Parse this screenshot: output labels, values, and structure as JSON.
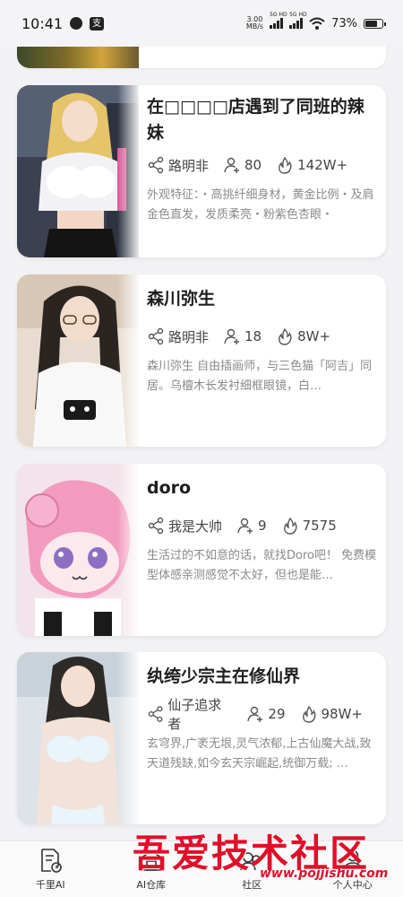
{
  "status_bar": {
    "time": "10:41",
    "notif_badge": "支",
    "net_speed_value": "3.00",
    "net_speed_unit": "MB/s",
    "sim1_tag": "5G HD",
    "sim2_tag": "5G HD",
    "battery": "73%"
  },
  "cards": [
    {
      "title": "在□□□□店遇到了同班的辣妹",
      "author": "路明非",
      "users": "80",
      "heat": "142W+",
      "description": "外观特征：・高挑纤细身材，黄金比例・及肩金色直发，发质柔亮・粉紫色杏眼・"
    },
    {
      "title": "森川弥生",
      "author": "路明非",
      "users": "18",
      "heat": "8W+",
      "description": "森川弥生 自由插画师，与三色猫「阿吉」同居。乌檀木长发衬细框眼镜，白…"
    },
    {
      "title": "doro",
      "author": "我是大帅",
      "users": "9",
      "heat": "7575",
      "description": "生活过的不如意的话，就找Doro吧！ 免费模型体感亲测感觉不太好，但也是能…"
    },
    {
      "title": "纨绔少宗主在修仙界",
      "author": "仙子追求者",
      "users": "29",
      "heat": "98W+",
      "description": "玄穹界,广袤无垠,灵气浓郁,上古仙魔大战,致天道残缺,如今玄天宗崛起,统御万载; …"
    }
  ],
  "nav": {
    "items": [
      {
        "label": "千里AI",
        "icon": "document-clock-icon"
      },
      {
        "label": "AI仓库",
        "icon": "warehouse-icon"
      },
      {
        "label": "社区",
        "icon": "community-icon"
      },
      {
        "label": "个人中心",
        "icon": "person-icon"
      }
    ]
  },
  "watermark": {
    "text": "吾爱技术社区",
    "url": "www.pojjishu.com"
  },
  "colors": {
    "background": "#f2f2f4",
    "card": "#ffffff",
    "watermark": "#e0102a",
    "muted_text": "#8a8a8a"
  }
}
